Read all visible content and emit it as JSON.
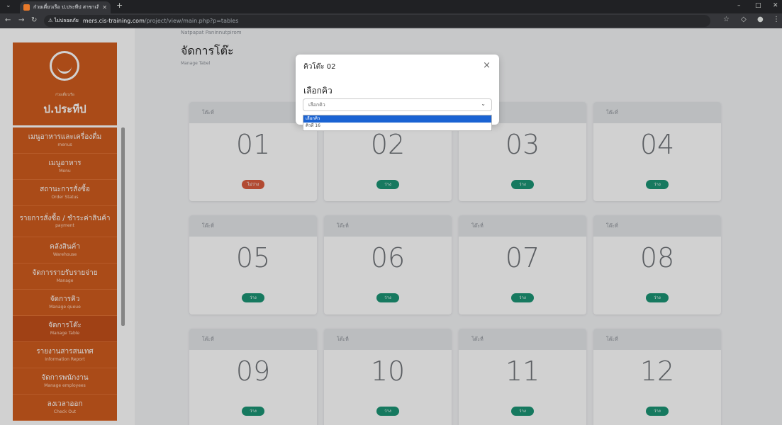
{
  "browser": {
    "tab_title": "ก๋วยเตี๋ยวเรือ ป.ประทีป สาขาเลียบถน",
    "url_warning": "ไม่ปลอดภัย",
    "url_host": "mers.cis-training.com",
    "url_path": "/project/view/main.php?p=tables"
  },
  "sidebar": {
    "logo_sub": "ก๋วยเตี๋ยวเรือ",
    "logo_name": "ป.ประทีป",
    "items": [
      {
        "label": "เมนูอาหารและเครื่องดื่ม",
        "sub": "menus"
      },
      {
        "label": "เมนูอาหาร",
        "sub": "Menu"
      },
      {
        "label": "สถานะการสั่งซื้อ",
        "sub": "Order Status"
      },
      {
        "label": "รายการสั่งซื้อ / ชำระค่าสินค้า",
        "sub": "payment"
      },
      {
        "label": "คลังสินค้า",
        "sub": "Warehouse"
      },
      {
        "label": "จัดการรายรับรายจ่าย",
        "sub": "Manage"
      },
      {
        "label": "จัดการคิว",
        "sub": "Manage queue"
      },
      {
        "label": "จัดการโต๊ะ",
        "sub": "Manage Table"
      },
      {
        "label": "รายงานสารสนเทศ",
        "sub": "Information Report"
      },
      {
        "label": "จัดการพนักงาน",
        "sub": "Manage employees"
      },
      {
        "label": "ลงเวลาออก",
        "sub": "Check Out"
      }
    ]
  },
  "main": {
    "user": "Natpapat Paninnutpirom",
    "title": "จัดการโต๊ะ",
    "subtitle": "Manage Tabel",
    "card_header": "โต๊ะที่",
    "tables": [
      {
        "num": "01",
        "status": "ไม่ว่าง",
        "status_color": "#d95b3d"
      },
      {
        "num": "02",
        "status": "ว่าง",
        "status_color": "#1c9474"
      },
      {
        "num": "03",
        "status": "ว่าง",
        "status_color": "#1c9474"
      },
      {
        "num": "04",
        "status": "ว่าง",
        "status_color": "#1c9474"
      },
      {
        "num": "05",
        "status": "ว่าง",
        "status_color": "#1c9474"
      },
      {
        "num": "06",
        "status": "ว่าง",
        "status_color": "#1c9474"
      },
      {
        "num": "07",
        "status": "ว่าง",
        "status_color": "#1c9474"
      },
      {
        "num": "08",
        "status": "ว่าง",
        "status_color": "#1c9474"
      },
      {
        "num": "09",
        "status": "ว่าง",
        "status_color": "#1c9474"
      },
      {
        "num": "10",
        "status": "ว่าง",
        "status_color": "#1c9474"
      },
      {
        "num": "11",
        "status": "ว่าง",
        "status_color": "#1c9474"
      },
      {
        "num": "12",
        "status": "ว่าง",
        "status_color": "#1c9474"
      }
    ]
  },
  "modal": {
    "title": "คิวโต๊ะ 02",
    "label": "เลือกคิว",
    "select_value": "เลือกคิว",
    "options": [
      "เลือกคิว",
      "คิวที่ 16"
    ]
  },
  "colors": {
    "brand": "#d05c1e",
    "available": "#1c9474",
    "busy": "#d95b3d"
  }
}
